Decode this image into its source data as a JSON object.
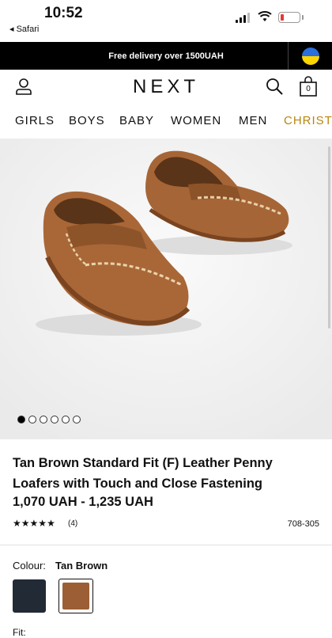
{
  "status": {
    "time": "10:52",
    "back_label": "◂ Safari"
  },
  "promo": {
    "text": "Free delivery over 1500UAH"
  },
  "header": {
    "logo": "NEXT",
    "bag_count": "0"
  },
  "nav": {
    "items": [
      "GIRLS",
      "BOYS",
      "BABY",
      "WOMEN",
      "MEN",
      "CHRISTM"
    ]
  },
  "gallery": {
    "total": 6,
    "active_index": 0
  },
  "product": {
    "title": "Tan Brown Standard Fit (F) Leather Penny Loafers with Touch and Close Fastening",
    "price": "1,070 UAH - 1,235 UAH",
    "rating_stars": 5,
    "review_count": "(4)",
    "item_code": "708-305"
  },
  "colour": {
    "label": "Colour:",
    "selected": "Tan Brown",
    "swatches": [
      {
        "name": "navy",
        "color": "#222a36"
      },
      {
        "name": "tan-brown",
        "color": "#9c5e34"
      }
    ]
  },
  "fit": {
    "label": "Fit:"
  },
  "colors": {
    "accent_nav": "#b8860b",
    "promo_bg": "#000000"
  }
}
